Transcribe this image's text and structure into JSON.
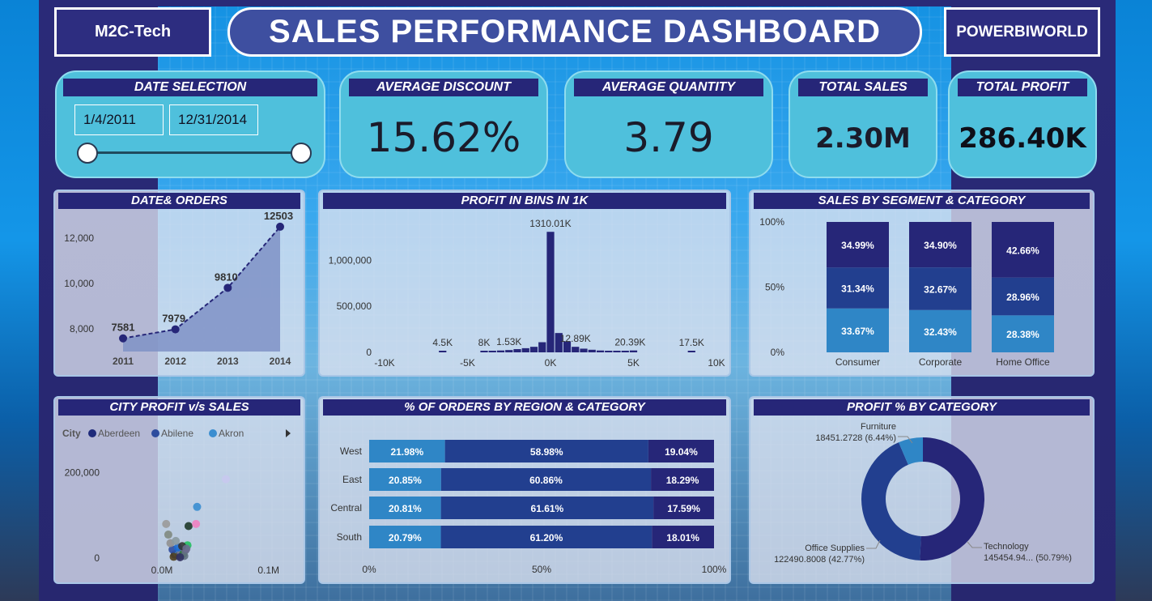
{
  "header": {
    "left_brand": "M2C-Tech",
    "title": "SALES PERFORMANCE DASHBOARD",
    "right_brand": "POWERBIWORLD"
  },
  "date_selection": {
    "label": "DATE SELECTION",
    "start": "1/4/2011",
    "end": "12/31/2014"
  },
  "kpis": {
    "avg_discount": {
      "label": "AVERAGE DISCOUNT",
      "value": "15.62%"
    },
    "avg_quantity": {
      "label": "AVERAGE QUANTITY",
      "value": "3.79"
    },
    "total_sales": {
      "label": "TOTAL SALES",
      "value": "2.30M"
    },
    "total_profit": {
      "label": "TOTAL PROFIT",
      "value": "286.40K"
    }
  },
  "colors": {
    "navy": "#262678",
    "mid_blue": "#223f8f",
    "light_blue": "#2f86c6",
    "kpi_bg": "#4fc0dc"
  },
  "chart_data": [
    {
      "id": "date_orders",
      "title": "DATE& ORDERS",
      "type": "area",
      "x": [
        "2011",
        "2012",
        "2013",
        "2014"
      ],
      "values": [
        7581,
        7979,
        9810,
        12503
      ],
      "data_labels": [
        "7581",
        "7979",
        "9810",
        "12503"
      ],
      "ylim": [
        7000,
        13000
      ],
      "y_ticks": [
        8000,
        10000,
        12000
      ],
      "y_tick_labels": [
        "8,000",
        "10,000",
        "12,000"
      ]
    },
    {
      "id": "profit_bins",
      "title": "PROFIT IN BINS IN 1K",
      "type": "bar",
      "x_tick_labels": [
        "-10K",
        "-5K",
        "0K",
        "5K",
        "10K"
      ],
      "x_ticks": [
        -10,
        -5,
        0,
        5,
        10
      ],
      "y_tick_labels": [
        "0",
        "500,000",
        "1,000,000"
      ],
      "y_ticks": [
        0,
        500000,
        1000000
      ],
      "ylim": [
        0,
        1400000
      ],
      "bins": [
        {
          "x": -6.5,
          "value": 4500,
          "label": "4.5K"
        },
        {
          "x": -4.0,
          "value": 8000,
          "label": "8K"
        },
        {
          "x": -3.5,
          "value": 12000
        },
        {
          "x": -3.0,
          "value": 20000
        },
        {
          "x": -2.5,
          "value": 25000
        },
        {
          "x": -2.0,
          "value": 35000
        },
        {
          "x": -1.5,
          "value": 45000
        },
        {
          "x": -1.0,
          "value": 60000
        },
        {
          "x": -0.5,
          "value": 110000
        },
        {
          "x": 0.0,
          "value": 1310010,
          "label": "1310.01K"
        },
        {
          "x": 0.5,
          "value": 210000
        },
        {
          "x": 1.0,
          "value": 120000
        },
        {
          "x": 1.5,
          "value": 60000
        },
        {
          "x": 2.0,
          "value": 40000
        },
        {
          "x": 2.5,
          "value": 28000
        },
        {
          "x": 3.0,
          "value": 20000
        },
        {
          "x": 3.5,
          "value": 15000
        },
        {
          "x": 4.0,
          "value": 12000
        },
        {
          "x": 4.5,
          "value": 9000
        },
        {
          "x": 5.0,
          "value": 20390
        },
        {
          "x": 8.5,
          "value": 17500
        }
      ],
      "data_labels": [
        {
          "x": -6.5,
          "text": "4.5K"
        },
        {
          "x": -4.0,
          "text": "8K"
        },
        {
          "x": -2.5,
          "text": "1.53K"
        },
        {
          "x": 0.0,
          "text": "1310.01K"
        },
        {
          "x": 1.5,
          "text": "12.89K"
        },
        {
          "x": 4.8,
          "text": "20.39K"
        },
        {
          "x": 8.5,
          "text": "17.5K"
        }
      ]
    },
    {
      "id": "segment_category",
      "title": "SALES BY SEGMENT & CATEGORY",
      "type": "bar",
      "stacked": "100%",
      "categories": [
        "Consumer",
        "Corporate",
        "Home Office"
      ],
      "series": [
        {
          "values": [
            33.67,
            32.43,
            28.38
          ],
          "labels": [
            "33.67%",
            "32.43%",
            "28.38%"
          ]
        },
        {
          "values": [
            31.34,
            32.67,
            28.96
          ],
          "labels": [
            "31.34%",
            "32.67%",
            "28.96%"
          ]
        },
        {
          "values": [
            34.99,
            34.9,
            42.66
          ],
          "labels": [
            "34.99%",
            "34.90%",
            "42.66%"
          ]
        }
      ],
      "y_tick_labels": [
        "0%",
        "50%",
        "100%"
      ]
    },
    {
      "id": "city_profit_sales",
      "title": "CITY PROFIT v/s SALES",
      "type": "scatter",
      "legend_title": "City",
      "legend": [
        "Aberdeen",
        "Abilene",
        "Akron"
      ],
      "legend_colors": [
        "#1e2a7a",
        "#2e4d9e",
        "#3a8ed0"
      ],
      "x_tick_labels": [
        "0.0M",
        "0.1M"
      ],
      "y_tick_labels": [
        "0",
        "200,000"
      ],
      "xlim": [
        0,
        0.12
      ],
      "ylim": [
        0,
        300000
      ],
      "points": [
        {
          "x": 0.012,
          "y": 8000,
          "c": "#1e2a7a"
        },
        {
          "x": 0.014,
          "y": 12000,
          "c": "#3a8ed0"
        },
        {
          "x": 0.016,
          "y": 6000,
          "c": "#5a5a5a"
        },
        {
          "x": 0.018,
          "y": 15000,
          "c": "#7a7a9a"
        },
        {
          "x": 0.01,
          "y": 20000,
          "c": "#2e4d9e"
        },
        {
          "x": 0.02,
          "y": 10000,
          "c": "#2b7a3a"
        },
        {
          "x": 0.022,
          "y": 18000,
          "c": "#6a6a8a"
        },
        {
          "x": 0.015,
          "y": 25000,
          "c": "#1a6ad0"
        },
        {
          "x": 0.024,
          "y": 30000,
          "c": "#22c060"
        },
        {
          "x": 0.019,
          "y": 28000,
          "c": "#353535"
        },
        {
          "x": 0.008,
          "y": 35000,
          "c": "#909090"
        },
        {
          "x": 0.013,
          "y": 40000,
          "c": "#8a9aa0"
        },
        {
          "x": 0.021,
          "y": 5000,
          "c": "#607080"
        },
        {
          "x": 0.011,
          "y": 3000,
          "c": "#504020"
        },
        {
          "x": 0.017,
          "y": 2000,
          "c": "#303060"
        },
        {
          "x": 0.023,
          "y": 22000,
          "c": "#6b6b8f"
        },
        {
          "x": 0.006,
          "y": 55000,
          "c": "#808a80"
        },
        {
          "x": 0.025,
          "y": 75000,
          "c": "#1f3a2a"
        },
        {
          "x": 0.032,
          "y": 80000,
          "c": "#f080c0"
        },
        {
          "x": 0.033,
          "y": 120000,
          "c": "#3a8ed0"
        },
        {
          "x": 0.004,
          "y": 80000,
          "c": "#9a9a9a"
        },
        {
          "x": 0.06,
          "y": 185000,
          "c": "#c8c8ee"
        }
      ]
    },
    {
      "id": "region_category",
      "title": "% OF ORDERS BY REGION & CATEGORY",
      "type": "bar",
      "stacked": "100%",
      "orientation": "horizontal",
      "categories": [
        "West",
        "East",
        "Central",
        "South"
      ],
      "series": [
        {
          "values": [
            21.98,
            20.85,
            20.81,
            20.79
          ],
          "labels": [
            "21.98%",
            "20.85%",
            "20.81%",
            "20.79%"
          ]
        },
        {
          "values": [
            58.98,
            60.86,
            61.61,
            61.2
          ],
          "labels": [
            "58.98%",
            "60.86%",
            "61.61%",
            "61.20%"
          ]
        },
        {
          "values": [
            19.04,
            18.29,
            17.59,
            18.01
          ],
          "labels": [
            "19.04%",
            "18.29%",
            "17.59%",
            "18.01%"
          ]
        }
      ],
      "x_tick_labels": [
        "0%",
        "50%",
        "100%"
      ]
    },
    {
      "id": "profit_category",
      "title": "PROFIT % BY CATEGORY",
      "type": "pie",
      "donut": true,
      "slices": [
        {
          "name": "Technology",
          "value": 145454.94,
          "label_value": "145454.94... (50.79%)"
        },
        {
          "name": "Office Supplies",
          "value": 122490.8008,
          "label_value": "122490.8008 (42.77%)"
        },
        {
          "name": "Furniture",
          "value": 18451.2728,
          "label_value": "18451.2728 (6.44%)"
        }
      ]
    }
  ]
}
